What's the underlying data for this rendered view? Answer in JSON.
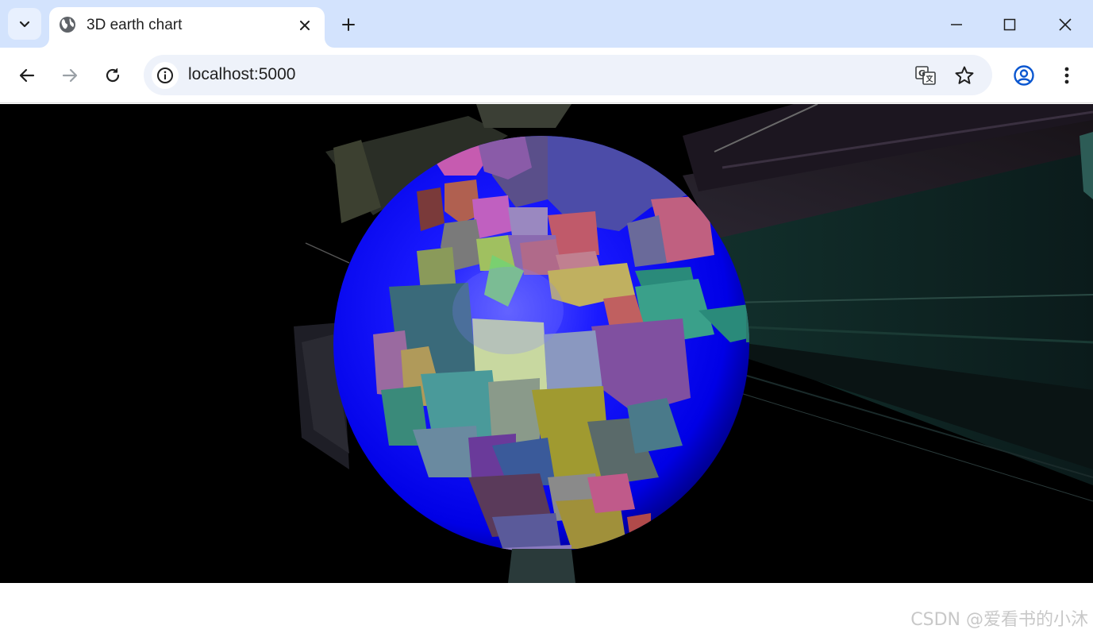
{
  "browser": {
    "tab": {
      "title": "3D earth chart",
      "favicon": "globe-icon"
    },
    "toolbar": {
      "url": "localhost:5000",
      "back_icon": "arrow-left-icon",
      "forward_icon": "arrow-right-icon",
      "reload_icon": "reload-icon",
      "site_info_icon": "info-icon",
      "translate_icon": "translate-icon",
      "bookmark_icon": "star-icon",
      "profile_icon": "account-icon",
      "menu_icon": "more-vertical-icon"
    },
    "window_controls": [
      "minimize-icon",
      "maximize-icon",
      "close-icon"
    ]
  },
  "page": {
    "chart": {
      "type": "3d-globe-with-extruded-country-polygons",
      "background_color": "#000000",
      "ocean_color": "#0a0aff"
    },
    "watermark": "CSDN @爱看书的小沐"
  },
  "colors": {
    "tabstrip": "#d3e3fd",
    "accent": "#0b57d0"
  }
}
